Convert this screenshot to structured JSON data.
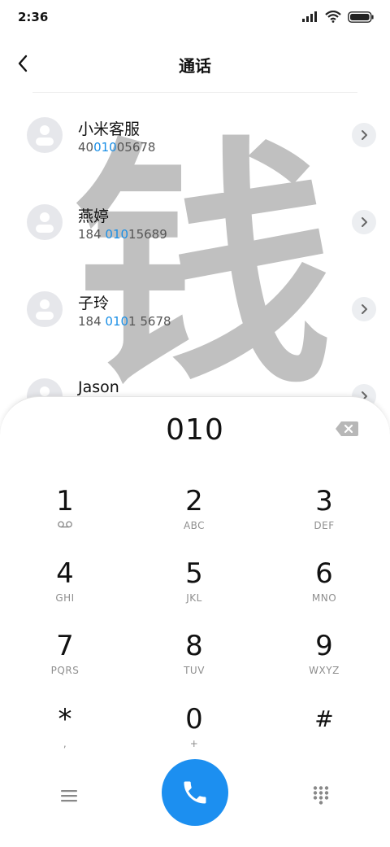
{
  "status_bar": {
    "time": "2:36"
  },
  "header": {
    "title": "通话"
  },
  "contacts": [
    {
      "name": "小米客服",
      "number_pre": "40",
      "number_hl": "010",
      "number_post": "05678"
    },
    {
      "name": "燕婷",
      "number_pre": "184 ",
      "number_hl": "010",
      "number_post": "15689"
    },
    {
      "name": "子玲",
      "number_pre": "184 ",
      "number_hl": "010",
      "number_post": "1 5678"
    },
    {
      "name": "Jason",
      "number_pre": "",
      "number_hl": "",
      "number_post": ""
    }
  ],
  "watermark": {
    "text": "钱"
  },
  "dialer": {
    "display": "010",
    "keys": [
      {
        "digit": "1",
        "letters": ""
      },
      {
        "digit": "2",
        "letters": "ABC"
      },
      {
        "digit": "3",
        "letters": "DEF"
      },
      {
        "digit": "4",
        "letters": "GHI"
      },
      {
        "digit": "5",
        "letters": "JKL"
      },
      {
        "digit": "6",
        "letters": "MNO"
      },
      {
        "digit": "7",
        "letters": "PQRS"
      },
      {
        "digit": "8",
        "letters": "TUV"
      },
      {
        "digit": "9",
        "letters": "WXYZ"
      },
      {
        "digit": "*",
        "letters": ","
      },
      {
        "digit": "0",
        "letters": "+"
      },
      {
        "digit": "#",
        "letters": ""
      }
    ]
  },
  "colors": {
    "accent": "#1c8ff0",
    "highlight": "#1a8fe6",
    "avatar_bg": "#e6e7eb"
  },
  "icons": {
    "back": "chevron-left-icon",
    "backspace": "backspace-icon",
    "voicemail": "voicemail-icon",
    "menu": "menu-icon",
    "call": "phone-icon",
    "keypad": "dialpad-icon",
    "contact_info": "chevron-right-icon"
  }
}
